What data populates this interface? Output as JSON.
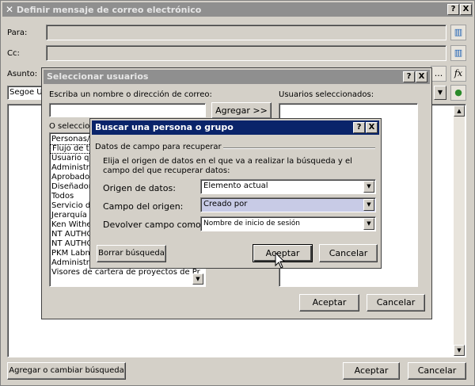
{
  "main": {
    "title": "Definir mensaje de correo electrónico",
    "to_label": "Para:",
    "cc_label": "Cc:",
    "subject_label": "Asunto:",
    "font_value": "Segoe UI",
    "more_label": "...",
    "fx_label": "fx",
    "help_label": "?",
    "close_label": "X",
    "add_change_label": "Agregar o cambiar búsqueda",
    "ok_label": "Aceptar",
    "cancel_label": "Cancelar"
  },
  "select_users": {
    "title": "Seleccionar usuarios",
    "prompt": "Escriba un nombre o dirección de correo:",
    "add_label": "Agregar >>",
    "selected_label": "Usuarios seleccionados:",
    "or_select_label": "O seleccion",
    "items": [
      "Personas/Grupos",
      "Flujo de trabajo",
      "Usuario que",
      "Administra",
      "Aprobado",
      "Diseñador",
      "Todos",
      "Servicio d",
      "Jerarquía",
      "Ken Withe",
      "NT AUTHO",
      "NT AUTHO",
      "PKM Labn",
      "Administradores de cartera de proye",
      "Visores de cartera de proyectos de Pr"
    ],
    "selected_index": 1,
    "ok_label": "Aceptar",
    "cancel_label": "Cancelar"
  },
  "lookup": {
    "title": "Buscar una persona o grupo",
    "group_label": "Datos de campo para recuperar",
    "description": "Elija el origen de datos en el que va a realizar la búsqueda y el campo del que recuperar datos:",
    "source_label": "Origen de datos:",
    "source_value": "Elemento actual",
    "field_label": "Campo del origen:",
    "field_value": "Creado por",
    "return_label": "Devolver campo como:",
    "return_value": "Nombre de inicio de sesión",
    "clear_label": "Borrar búsqueda",
    "ok_label": "Aceptar",
    "cancel_label": "Cancelar"
  }
}
